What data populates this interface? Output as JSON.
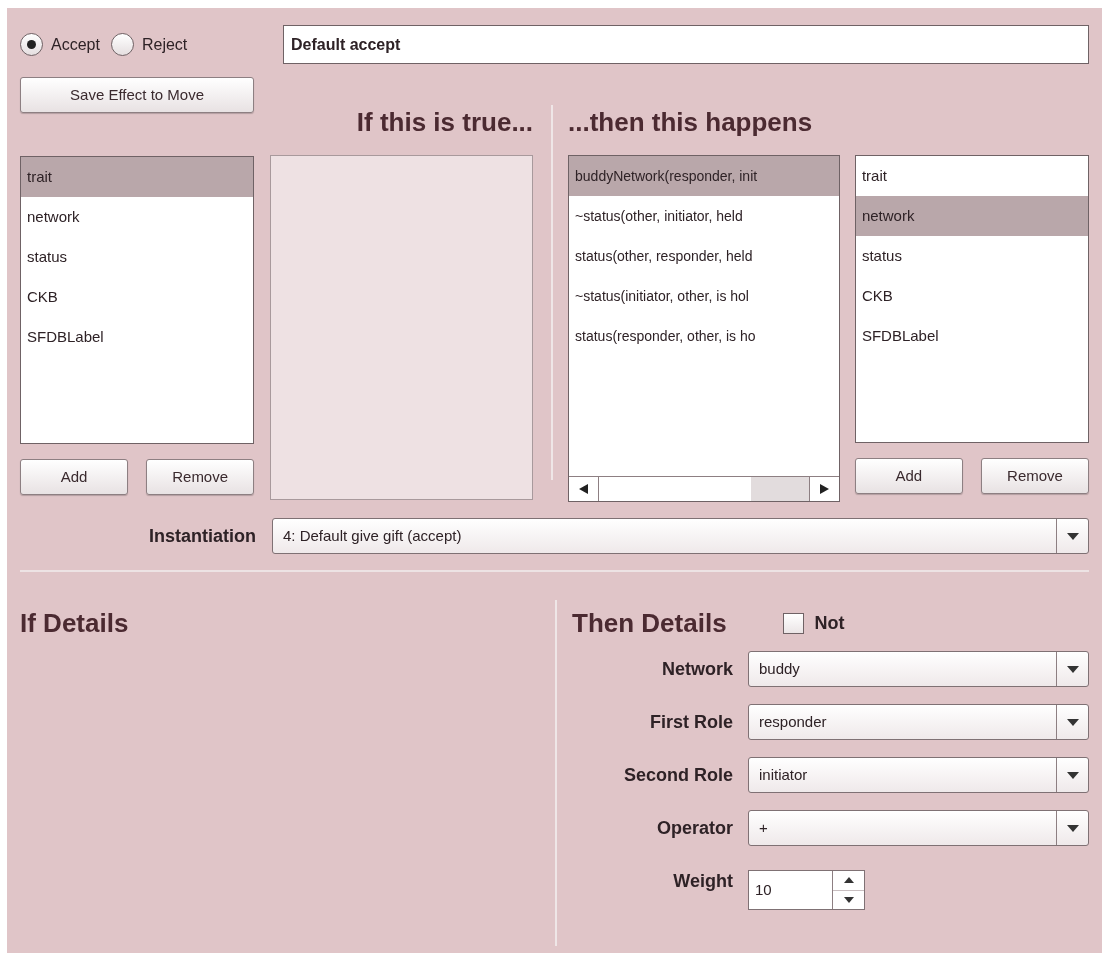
{
  "outcome": [
    {
      "label": "Accept",
      "selected": true
    },
    {
      "label": "Reject",
      "selected": false
    }
  ],
  "name_field": {
    "value": "Default accept"
  },
  "save_button": "Save Effect to Move",
  "if_section": {
    "heading": "If this is true...",
    "type_list": [
      {
        "label": "trait",
        "selected": true
      },
      {
        "label": "network",
        "selected": false
      },
      {
        "label": "status",
        "selected": false
      },
      {
        "label": "CKB",
        "selected": false
      },
      {
        "label": "SFDBLabel",
        "selected": false
      }
    ],
    "buttons": [
      "Add",
      "Remove"
    ]
  },
  "then_section": {
    "heading": "...then this happens",
    "effects": [
      {
        "label": "buddyNetwork(responder, init",
        "selected": true
      },
      {
        "label": "~status(other, initiator, held",
        "selected": false
      },
      {
        "label": "status(other, responder, held",
        "selected": false
      },
      {
        "label": "~status(initiator, other, is hol",
        "selected": false
      },
      {
        "label": "status(responder, other, is ho",
        "selected": false
      }
    ],
    "type_list": [
      {
        "label": "trait",
        "selected": false
      },
      {
        "label": "network",
        "selected": true
      },
      {
        "label": "status",
        "selected": false
      },
      {
        "label": "CKB",
        "selected": false
      },
      {
        "label": "SFDBLabel",
        "selected": false
      }
    ],
    "buttons": [
      "Add",
      "Remove"
    ]
  },
  "instantiation": {
    "label": "Instantiation",
    "value": "4: Default give gift (accept)"
  },
  "if_details": {
    "heading": "If Details"
  },
  "then_details": {
    "heading": "Then Details",
    "not_checkbox": {
      "label": "Not",
      "checked": false
    },
    "fields": [
      {
        "label": "Network",
        "kind": "dropdown",
        "value": "buddy"
      },
      {
        "label": "First Role",
        "kind": "dropdown",
        "value": "responder"
      },
      {
        "label": "Second Role",
        "kind": "dropdown",
        "value": "initiator"
      },
      {
        "label": "Operator",
        "kind": "dropdown",
        "value": "+"
      },
      {
        "label": "Weight",
        "kind": "spinner",
        "value": "10"
      }
    ]
  }
}
